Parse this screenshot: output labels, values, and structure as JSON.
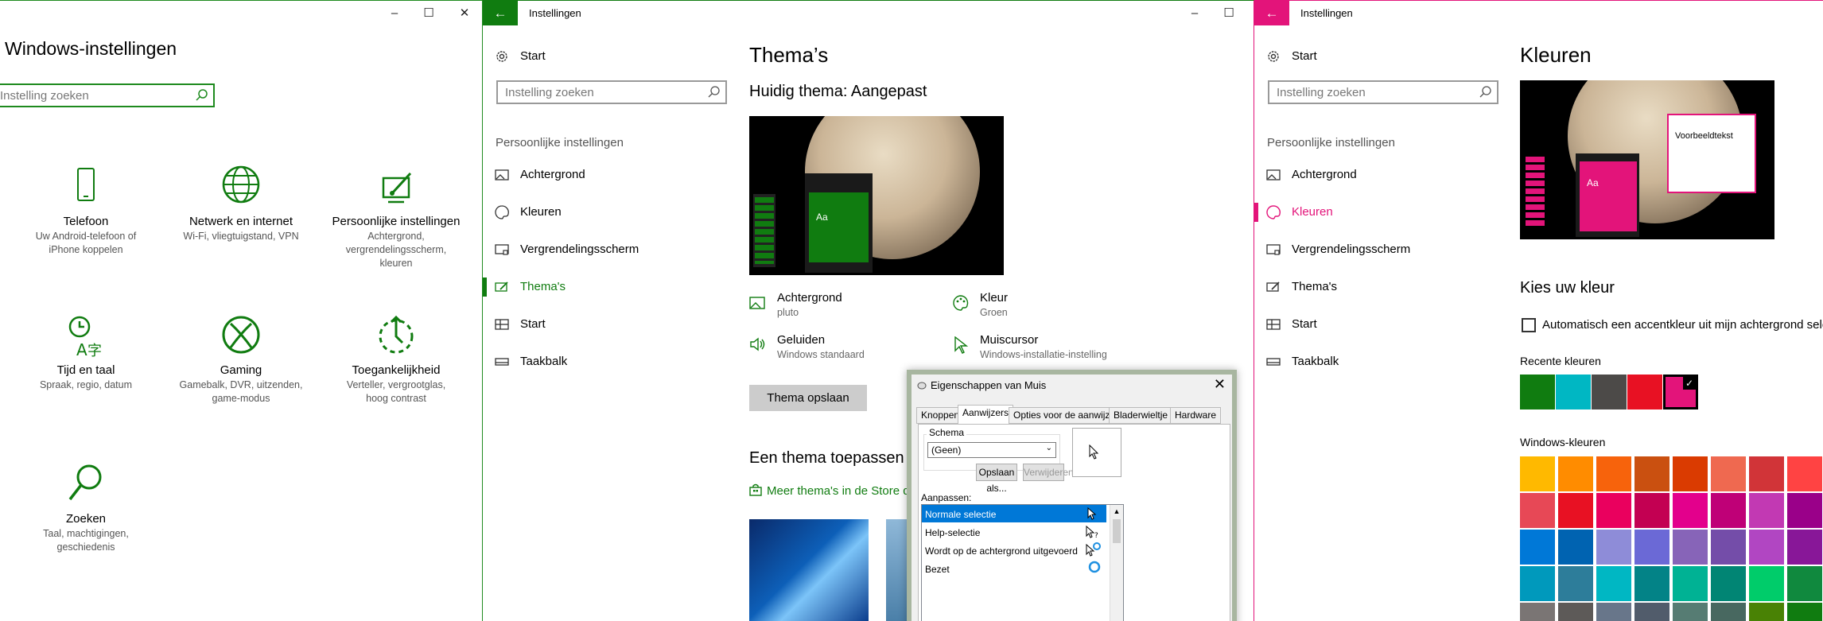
{
  "colors": {
    "green_accent": "#107c10",
    "pink_accent": "#e3147a",
    "recent": [
      "#107c10",
      "#00b7c3",
      "#4c4a48",
      "#e81123",
      "#e3147a"
    ],
    "windows": [
      [
        "#ffb900",
        "#ff8c00",
        "#f7630c",
        "#ca5010",
        "#da3b01",
        "#ef6950",
        "#d13438",
        "#ff4343"
      ],
      [
        "#e74856",
        "#e81123",
        "#ea005e",
        "#c30052",
        "#e3008c",
        "#bf0077",
        "#c239b3",
        "#9a0089"
      ],
      [
        "#0078d7",
        "#0063b1",
        "#8e8cd8",
        "#6b69d6",
        "#8764b8",
        "#744da9",
        "#b146c2",
        "#881798"
      ],
      [
        "#0099bc",
        "#2d7d9a",
        "#00b7c3",
        "#038387",
        "#00b294",
        "#018574",
        "#00cc6a",
        "#10893e"
      ],
      [
        "#7a7574",
        "#5d5a58",
        "#68768a",
        "#515c6b",
        "#567c73",
        "#486860",
        "#498205",
        "#107c10"
      ]
    ]
  },
  "w1": {
    "title": "Windows-instellingen",
    "search_placeholder": "Instelling zoeken",
    "tiles": [
      {
        "icon": "phone-icon",
        "name": "Telefoon",
        "desc": "Uw Android-telefoon of iPhone koppelen"
      },
      {
        "icon": "globe-icon",
        "name": "Netwerk en internet",
        "desc": "Wi-Fi, vliegtuigstand, VPN"
      },
      {
        "icon": "personalization-icon",
        "name": "Persoonlijke instellingen",
        "desc": "Achtergrond, vergrendelingsscherm, kleuren"
      },
      {
        "icon": "time-language-icon",
        "name": "Tijd en taal",
        "desc": "Spraak, regio, datum"
      },
      {
        "icon": "xbox-icon",
        "name": "Gaming",
        "desc": "Gamebalk, DVR, uitzenden, game-modus"
      },
      {
        "icon": "ease-of-access-icon",
        "name": "Toegankelijkheid",
        "desc": "Verteller, vergrootglas, hoog contrast"
      },
      {
        "icon": "search-icon",
        "name": "Zoeken",
        "desc": "Taal, machtigingen, geschiedenis"
      }
    ]
  },
  "nav": {
    "app_title": "Instellingen",
    "start": "Start",
    "search_placeholder": "Instelling zoeken",
    "section": "Persoonlijke instellingen",
    "items": [
      "Achtergrond",
      "Kleuren",
      "Vergrendelingsscherm",
      "Thema's",
      "Start",
      "Taakbalk"
    ]
  },
  "themes": {
    "title": "Thema’s",
    "current": "Huidig thema: Aangepast",
    "preview_aa": "Aa",
    "props": [
      {
        "label": "Achtergrond",
        "value": "pluto"
      },
      {
        "label": "Kleur",
        "value": "Groen"
      },
      {
        "label": "Geluiden",
        "value": "Windows standaard"
      },
      {
        "label": "Muiscursor",
        "value": "Windows-installatie-instelling"
      }
    ],
    "save_button": "Thema opslaan",
    "apply_title": "Een thema toepassen",
    "store_link": "Meer thema's in de Store downloaden"
  },
  "dialog": {
    "title": "Eigenschappen van Muis",
    "tabs": [
      "Knoppen",
      "Aanwijzers",
      "Opties voor de aanwijzer",
      "Bladerwieltje",
      "Hardware"
    ],
    "schema_label": "Schema",
    "schema_value": "(Geen)",
    "save_as": "Opslaan als...",
    "delete": "Verwijderen",
    "customize_label": "Aanpassen:",
    "list": [
      "Normale selectie",
      "Help-selectie",
      "Wordt op de achtergrond uitgevoerd",
      "Bezet"
    ]
  },
  "colors_page": {
    "title": "Kleuren",
    "preview_aa": "Aa",
    "sample_text": "Voorbeeldtekst",
    "choose_title": "Kies uw kleur",
    "auto_accent": "Automatisch een accentkleur uit mijn achtergrond selecteren",
    "recent_label": "Recente kleuren",
    "windows_label": "Windows-kleuren"
  }
}
